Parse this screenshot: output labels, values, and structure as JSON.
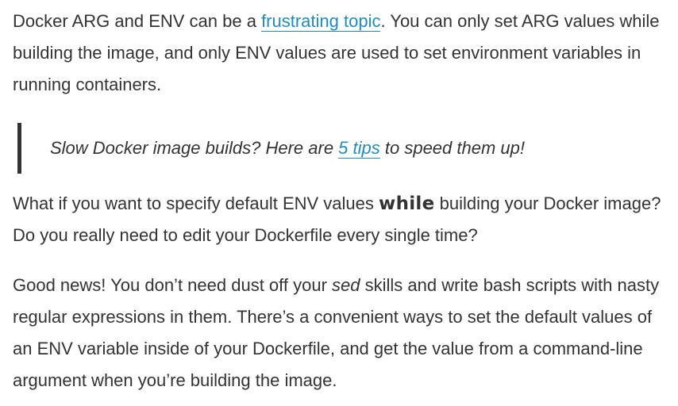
{
  "paragraph1": {
    "before_link": "Docker ARG and ENV can be a ",
    "link_text": "frustrating topic",
    "after_link": ". You can only set ARG values while building the image, and only ENV values are used to set environment variables in running containers."
  },
  "quote": {
    "before_link": "Slow Docker image builds? Here are ",
    "link_text": "5 tips",
    "after_link": " to speed them up!"
  },
  "paragraph2": {
    "before_bold": "What if you want to specify default ENV values ",
    "bold": "while",
    "after_bold": " building your Docker image? Do you really need to edit your Dockerfile every single time?"
  },
  "paragraph3": {
    "before_em": "Good news! You don’t need dust off your ",
    "em": "sed",
    "after_em": " skills and write bash scripts with nasty regular expressions in them. There’s a convenient ways to set the default values of an ENV variable inside of your Dockerfile, and get the value from a command-line argument when you’re building the image."
  },
  "colors": {
    "text": "#333333",
    "link": "#1e8bc3",
    "quote_border": "#333333"
  }
}
